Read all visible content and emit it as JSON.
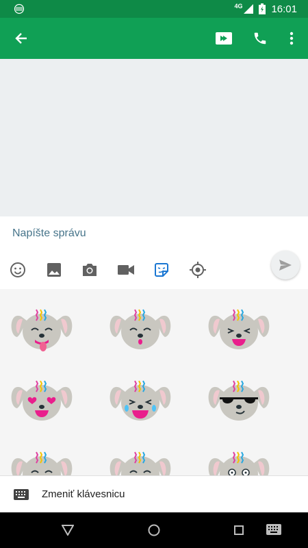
{
  "status_bar": {
    "network": "4G",
    "time": "16:01"
  },
  "compose": {
    "placeholder": "Napíšte správu"
  },
  "keyboard_switch": {
    "label": "Zmeniť klávesnicu"
  },
  "stickers": [
    "dog-tongue",
    "dog-surprised",
    "dog-laughing",
    "dog-heart-eyes",
    "dog-crying-laughing",
    "dog-sunglasses",
    "dog-kiss",
    "dog-teary",
    "dog-dizzy"
  ],
  "colors": {
    "status_bar": "#0e8a47",
    "app_bar": "#10a055",
    "placeholder": "#46748a"
  }
}
